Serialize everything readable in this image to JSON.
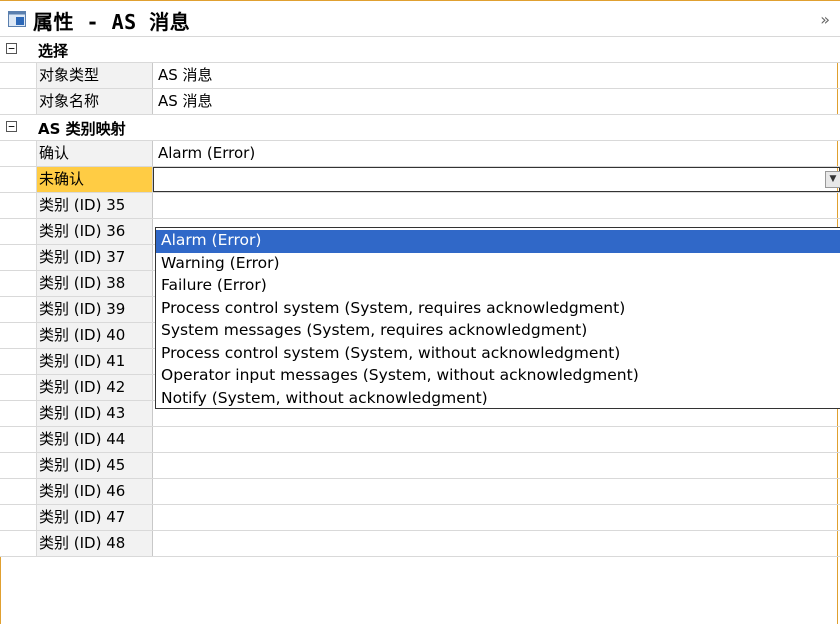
{
  "title": {
    "text": "属性 - AS 消息",
    "collapse_glyph": "»",
    "icon": "properties-window-icon"
  },
  "categories": [
    {
      "label": "选择",
      "toggle": "−",
      "rows": [
        {
          "name": "对象类型",
          "value": "AS 消息"
        },
        {
          "name": "对象名称",
          "value": "AS 消息"
        }
      ]
    },
    {
      "label": "AS 类别映射",
      "toggle": "−",
      "rows": [
        {
          "name": "确认",
          "value": "Alarm (Error)"
        },
        {
          "name": "未确认",
          "value": ""
        },
        {
          "name": "类别 (ID) 35",
          "value": ""
        },
        {
          "name": "类别 (ID) 36",
          "value": ""
        },
        {
          "name": "类别 (ID) 37",
          "value": ""
        },
        {
          "name": "类别 (ID) 38",
          "value": ""
        },
        {
          "name": "类别 (ID) 39",
          "value": ""
        },
        {
          "name": "类别 (ID) 40",
          "value": ""
        },
        {
          "name": "类别 (ID) 41",
          "value": ""
        },
        {
          "name": "类别 (ID) 42",
          "value": ""
        },
        {
          "name": "类别 (ID) 43",
          "value": ""
        },
        {
          "name": "类别 (ID) 44",
          "value": ""
        },
        {
          "name": "类别 (ID) 45",
          "value": ""
        },
        {
          "name": "类别 (ID) 46",
          "value": ""
        },
        {
          "name": "类别 (ID) 47",
          "value": ""
        },
        {
          "name": "类别 (ID) 48",
          "value": ""
        }
      ]
    }
  ],
  "dropdown": {
    "arrow_glyph": "▼",
    "selected_index": 0,
    "options": [
      "Alarm (Error)",
      "Warning (Error)",
      "Failure (Error)",
      "Process control system (System, requires acknowledgment)",
      "System messages (System, requires acknowledgment)",
      "Process control system (System, without acknowledgment)",
      "Operator input messages (System, without acknowledgment)",
      "Notify (System, without acknowledgment)"
    ]
  },
  "colors": {
    "accent_border": "#e0a030",
    "selected_row": "#ffcc44",
    "list_highlight": "#3068c8"
  }
}
